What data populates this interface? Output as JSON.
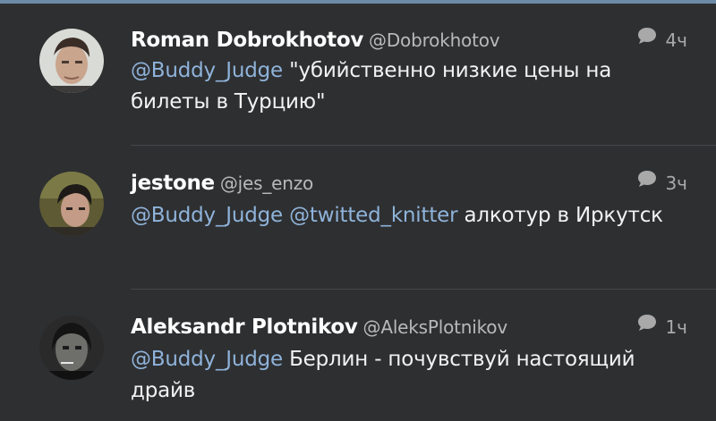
{
  "colors": {
    "background": "#2e2f31",
    "accent_bar": "#6d8aa6",
    "mention": "#8fb3da",
    "name": "#ffffff",
    "handle": "#b9b9b9",
    "divider": "#454649"
  },
  "tweets": [
    {
      "name": "Roman Dobrokhotov",
      "handle": "@Dobrokhotov",
      "time": "4ч",
      "mention": "@Buddy_Judge",
      "text": " \"убийственно низкие цены на билеты в Турцию\""
    },
    {
      "name": "jestone",
      "handle": "@jes_enzo",
      "time": "3ч",
      "mention": "@Buddy_Judge",
      "mention2": "@twitted_knitter",
      "text": " алкотур в Иркутск"
    },
    {
      "name": "Aleksandr Plotnikov",
      "handle": "@AleksPlotnikov",
      "time": "1ч",
      "mention": "@Buddy_Judge",
      "text": " Берлин - почувствуй настоящий драйв"
    }
  ],
  "icons": {
    "reply": "speech-bubble-icon",
    "avatar": "avatar"
  }
}
